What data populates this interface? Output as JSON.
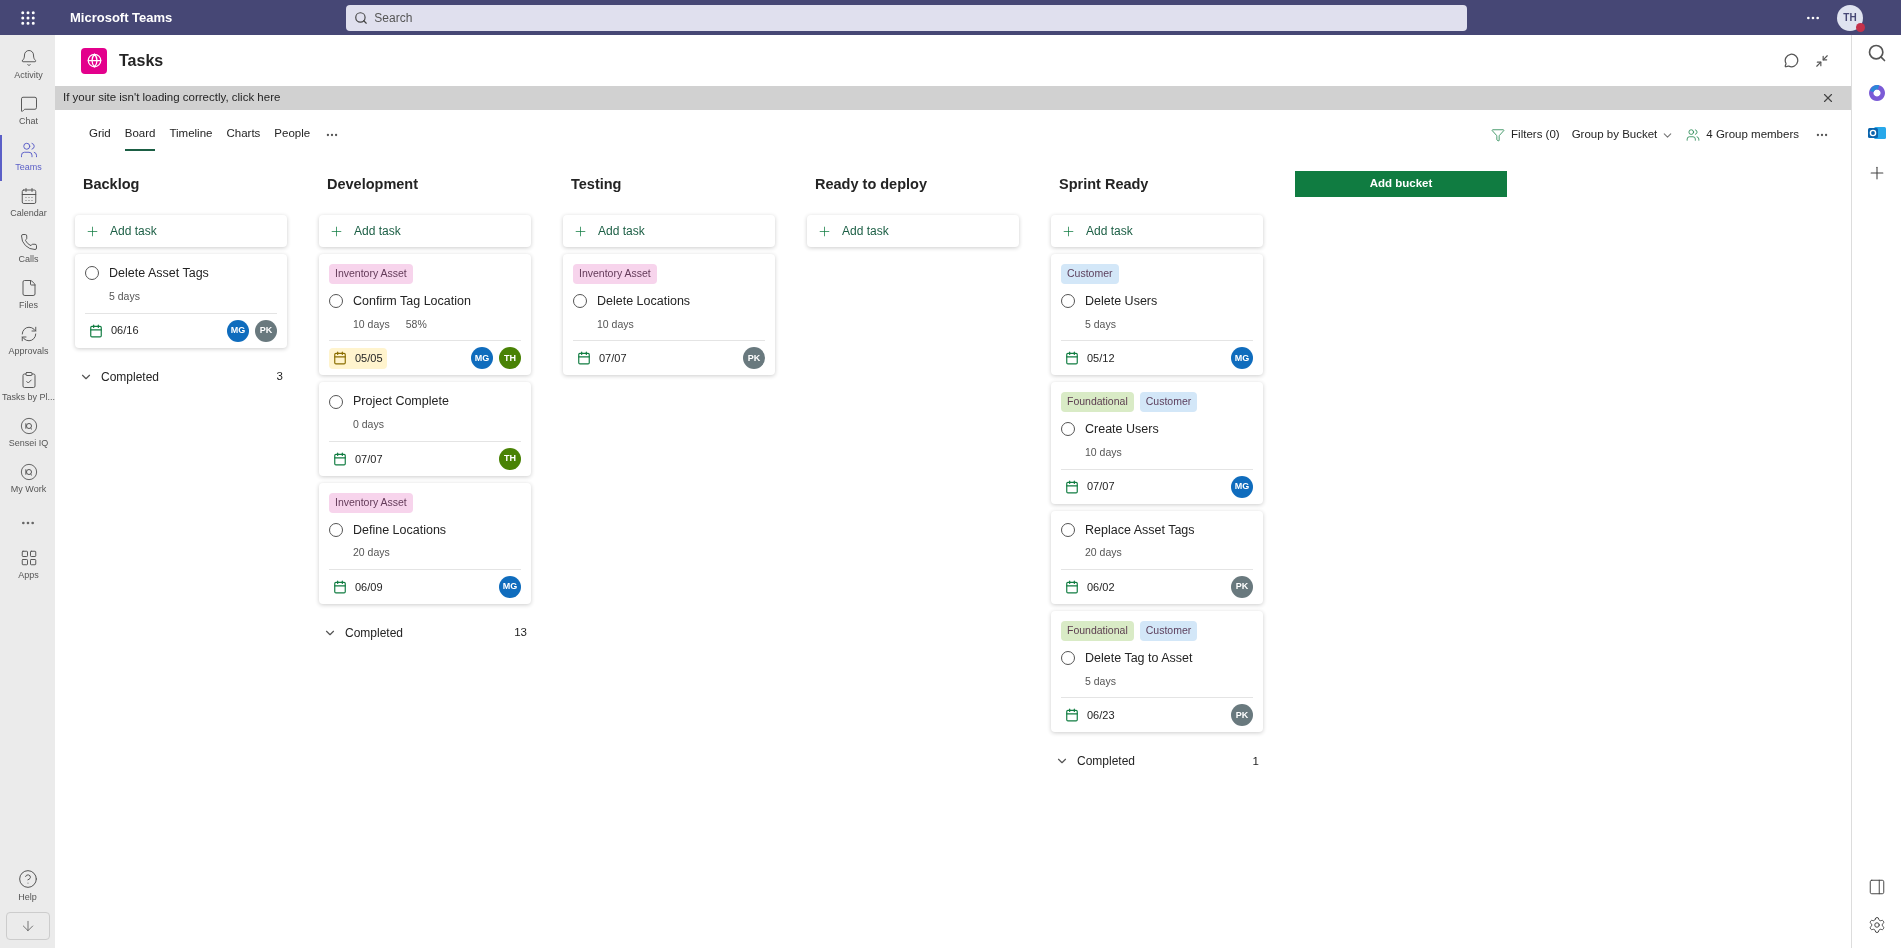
{
  "app_bar": {
    "title": "Microsoft Teams",
    "search": {
      "placeholder": "Search"
    },
    "avatar": {
      "initials": "TH",
      "busy": true
    }
  },
  "rail": {
    "items": [
      {
        "label": "Activity",
        "selected": false
      },
      {
        "label": "Chat",
        "selected": false
      },
      {
        "label": "Teams",
        "selected": true
      },
      {
        "label": "Calendar",
        "selected": false
      },
      {
        "label": "Calls",
        "selected": false
      },
      {
        "label": "Files",
        "selected": false
      },
      {
        "label": "Approvals",
        "selected": false
      },
      {
        "label": "Tasks by Pl...",
        "selected": false
      },
      {
        "label": "Sensei IQ",
        "selected": false
      },
      {
        "label": "My Work",
        "selected": false
      },
      {
        "label": "Apps",
        "selected": false
      }
    ],
    "help": "Help"
  },
  "page": {
    "title": "Tasks",
    "banner": "If your site isn't loading correctly, click here"
  },
  "tabs": [
    {
      "label": "Grid",
      "selected": false
    },
    {
      "label": "Board",
      "selected": true
    },
    {
      "label": "Timeline",
      "selected": false
    },
    {
      "label": "Charts",
      "selected": false
    },
    {
      "label": "People",
      "selected": false
    }
  ],
  "toolbar": {
    "filters": "Filters (0)",
    "group_by": "Group by Bucket",
    "members": "4 Group members"
  },
  "add_bucket": "Add bucket",
  "buckets": [
    {
      "name": "Backlog",
      "add_task": "Add task",
      "tasks": [
        {
          "title": "Delete Asset Tags",
          "duration": "5 days",
          "date": "06/16",
          "date_flagged": false,
          "assignees": [
            {
              "initials": "MG",
              "color": "#0f6cbd"
            },
            {
              "initials": "PK",
              "color": "#69797e"
            }
          ]
        }
      ],
      "completed": {
        "label": "Completed",
        "count": "3"
      }
    },
    {
      "name": "Development",
      "add_task": "Add task",
      "tasks": [
        {
          "labels": [
            {
              "text": "Inventory Asset",
              "color": "#f7d4ec"
            }
          ],
          "title": "Confirm Tag Location",
          "duration": "10 days",
          "progress": "58%",
          "date": "05/05",
          "date_flagged": true,
          "assignees": [
            {
              "initials": "MG",
              "color": "#0f6cbd"
            },
            {
              "initials": "TH",
              "color": "#498205"
            }
          ]
        },
        {
          "title": "Project Complete",
          "duration": "0 days",
          "date": "07/07",
          "date_flagged": false,
          "assignees": [
            {
              "initials": "TH",
              "color": "#498205"
            }
          ]
        },
        {
          "labels": [
            {
              "text": "Inventory Asset",
              "color": "#f7d4ec"
            }
          ],
          "title": "Define Locations",
          "duration": "20 days",
          "date": "06/09",
          "date_flagged": false,
          "assignees": [
            {
              "initials": "MG",
              "color": "#0f6cbd"
            }
          ]
        }
      ],
      "completed": {
        "label": "Completed",
        "count": "13"
      }
    },
    {
      "name": "Testing",
      "add_task": "Add task",
      "tasks": [
        {
          "labels": [
            {
              "text": "Inventory Asset",
              "color": "#f7d4ec"
            }
          ],
          "title": "Delete Locations",
          "duration": "10 days",
          "date": "07/07",
          "date_flagged": false,
          "assignees": [
            {
              "initials": "PK",
              "color": "#69797e"
            }
          ]
        }
      ]
    },
    {
      "name": "Ready to deploy",
      "add_task": "Add task"
    },
    {
      "name": "Sprint Ready",
      "add_task": "Add task",
      "tasks": [
        {
          "labels": [
            {
              "text": "Customer",
              "color": "#d3e7f8"
            }
          ],
          "title": "Delete Users",
          "duration": "5 days",
          "date": "05/12",
          "date_flagged": false,
          "assignees": [
            {
              "initials": "MG",
              "color": "#0f6cbd"
            }
          ]
        },
        {
          "labels": [
            {
              "text": "Foundational",
              "color": "#d9ebc6"
            },
            {
              "text": "Customer",
              "color": "#d3e7f8"
            }
          ],
          "title": "Create Users",
          "duration": "10 days",
          "date": "07/07",
          "date_flagged": false,
          "assignees": [
            {
              "initials": "MG",
              "color": "#0f6cbd"
            }
          ]
        },
        {
          "title": "Replace Asset Tags",
          "duration": "20 days",
          "date": "06/02",
          "date_flagged": false,
          "assignees": [
            {
              "initials": "PK",
              "color": "#69797e"
            }
          ]
        },
        {
          "labels": [
            {
              "text": "Foundational",
              "color": "#d9ebc6"
            },
            {
              "text": "Customer",
              "color": "#d3e7f8"
            }
          ],
          "title": "Delete Tag to Asset",
          "duration": "5 days",
          "date": "06/23",
          "date_flagged": false,
          "assignees": [
            {
              "initials": "PK",
              "color": "#69797e"
            }
          ]
        }
      ],
      "completed": {
        "label": "Completed",
        "count": "1"
      }
    }
  ]
}
